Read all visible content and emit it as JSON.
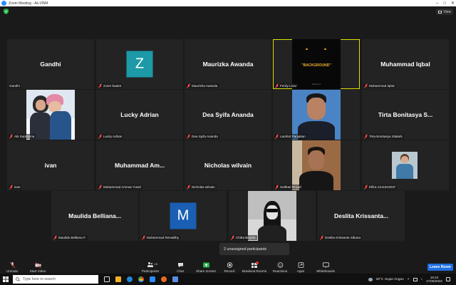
{
  "window": {
    "title": "Zoom Meeting - Ak-VIM4",
    "view_label": "View"
  },
  "tiles": [
    {
      "display_name": "Gandhi",
      "label": "Gandhi",
      "mic_off": false
    },
    {
      "avatar_letter": "Z",
      "avatar_color": "#1c9aa8",
      "label": "zoom baa04",
      "mic_off": true
    },
    {
      "display_name": "Maurizka Awanda",
      "label": "Maurizka Awanda",
      "mic_off": true
    },
    {
      "video_text": "\"BACKGROUND\"",
      "video_caption": "Bandung 2",
      "label": "Ferdy Linar",
      "mic_off": true,
      "active_speaker": true
    },
    {
      "display_name": "Muhammad Iqbal",
      "label": "Muhammad Iqbal",
      "mic_off": true
    },
    {
      "label": "Aik Septiarina",
      "mic_off": true
    },
    {
      "display_name": "Lucky Adrian",
      "label": "Lucky Adrian",
      "mic_off": true
    },
    {
      "display_name": "Dea Syifa Ananda",
      "label": "Dea Syifa Ananda",
      "mic_off": true
    },
    {
      "label": "Lamhot Panjaitan",
      "mic_off": true
    },
    {
      "display_name": "Tirta Bonitasya S...",
      "label": "Tirta Bonitasya Silalahi",
      "mic_off": true
    },
    {
      "display_name": "ivan",
      "label": "ivan",
      "mic_off": true
    },
    {
      "display_name": "Muhammad Am...",
      "label": "Muhammad Ammar Yusuf",
      "mic_off": true
    },
    {
      "display_name": "Nicholas wilvain",
      "label": "Nicholas wilvain",
      "mic_off": true
    },
    {
      "label": "Sulthan Rizjad",
      "mic_off": true
    },
    {
      "label": "Elfira-1211910037",
      "mic_off": true
    },
    {
      "display_name": "Maulida Belliana...",
      "label": "Maulida Belliana F.",
      "mic_off": true
    },
    {
      "avatar_letter": "M",
      "avatar_color": "#1a5fb4",
      "label": "Muhammad Renaldhy",
      "mic_off": true
    },
    {
      "label": "Chitta Brigitta",
      "mic_off": true
    },
    {
      "display_name": "Deslita  Krissanta...",
      "label": "Deslita Krissanta Sibuea",
      "mic_off": true
    }
  ],
  "unassigned": "2 unassigned participants",
  "controls": {
    "unmute": "Unmute",
    "start_video": "Start Video",
    "participants": "Participants",
    "participants_count": "19",
    "chat": "Chat",
    "share_screen": "Share Screen",
    "record": "Record",
    "breakout_rooms": "Breakout Rooms",
    "reactions": "Reactions",
    "apps": "Apps",
    "whiteboards": "Whiteboards",
    "leave_room": "Leave Room"
  },
  "taskbar": {
    "search_placeholder": "Type here to search",
    "weather": "29°C  Hujan ringan",
    "time": "18:43",
    "date": "17/05/2022"
  }
}
